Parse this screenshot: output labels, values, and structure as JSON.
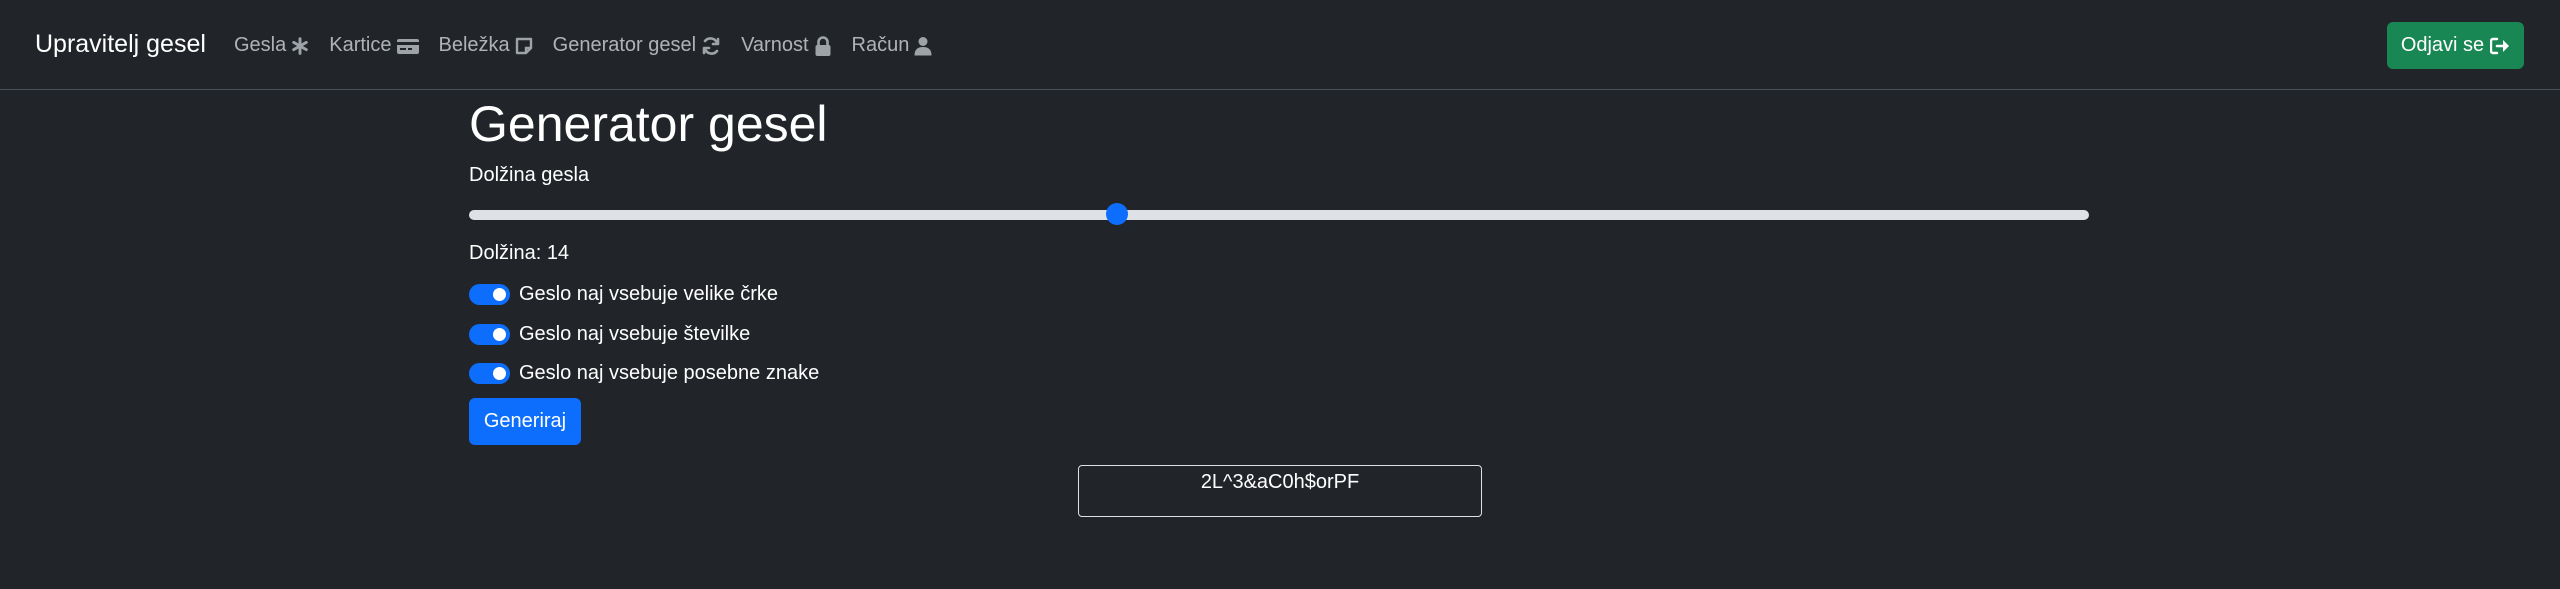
{
  "navbar": {
    "brand": "Upravitelj gesel",
    "items": [
      {
        "label": "Gesla",
        "icon": "asterisk-icon"
      },
      {
        "label": "Kartice",
        "icon": "credit-card-icon"
      },
      {
        "label": "Beležka",
        "icon": "sticky-note-icon"
      },
      {
        "label": "Generator gesel",
        "icon": "sync-icon"
      },
      {
        "label": "Varnost",
        "icon": "lock-icon"
      },
      {
        "label": "Račun",
        "icon": "user-icon"
      }
    ],
    "logout_label": "Odjavi se",
    "logout_icon": "sign-out-icon"
  },
  "main": {
    "title": "Generator gesel",
    "length_label": "Dolžina gesla",
    "length_display": "Dolžina: 14",
    "length_slider": {
      "value": 14,
      "fraction": 0.4
    },
    "options": [
      {
        "label": "Geslo naj vsebuje velike črke",
        "checked": true
      },
      {
        "label": "Geslo naj vsebuje številke",
        "checked": true
      },
      {
        "label": "Geslo naj vsebuje posebne znake",
        "checked": true
      }
    ],
    "generate_label": "Generiraj",
    "generated_password": "2L^3&aC0h$orPF"
  },
  "colors": {
    "background": "#212529",
    "primary": "#0d6efd",
    "success": "#198754"
  }
}
